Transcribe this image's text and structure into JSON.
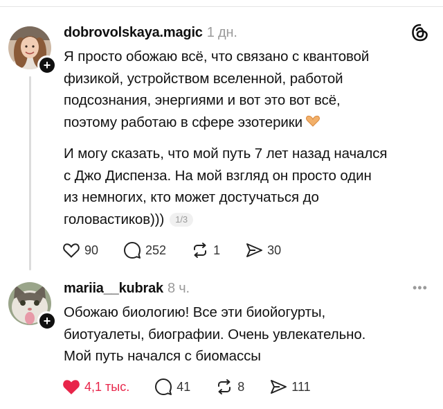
{
  "posts": [
    {
      "username": "dobrovolskaya.magic",
      "time": "1 дн.",
      "paragraphs": [
        [
          "Я просто обожаю всё, что связано с квантовой",
          "физикой, устройством вселенной, работой",
          "подсознания, энергиями и вот это вот всё,",
          "поэтому работаю в сфере эзотерики"
        ],
        [
          "И могу сказать, что мой путь 7 лет назад начался",
          "с Джо Диспенза. На мой взгляд он просто один",
          "из немногих, кто может достучаться до",
          "головастиков)))"
        ]
      ],
      "pager": "1/3",
      "likes": "90",
      "comments": "252",
      "reposts": "1",
      "shares": "30",
      "emoji": "heart-hands-emoji",
      "corner_icon": "threads-logo-icon"
    },
    {
      "username": "mariia__kubrak",
      "time": "8 ч.",
      "paragraphs": [
        [
          "Обожаю биологию! Все эти биойогурты,",
          "биотуалеты, биографии. Очень увлекательно.",
          "Мой путь начался с биомассы"
        ]
      ],
      "likes": "4,1 тыс.",
      "comments": "41",
      "reposts": "8",
      "shares": "111",
      "liked": true,
      "corner_icon": "more-options-icon"
    }
  ],
  "colors": {
    "like_active": "#e8254a",
    "muted": "#9a9a9a",
    "text": "#101010"
  }
}
